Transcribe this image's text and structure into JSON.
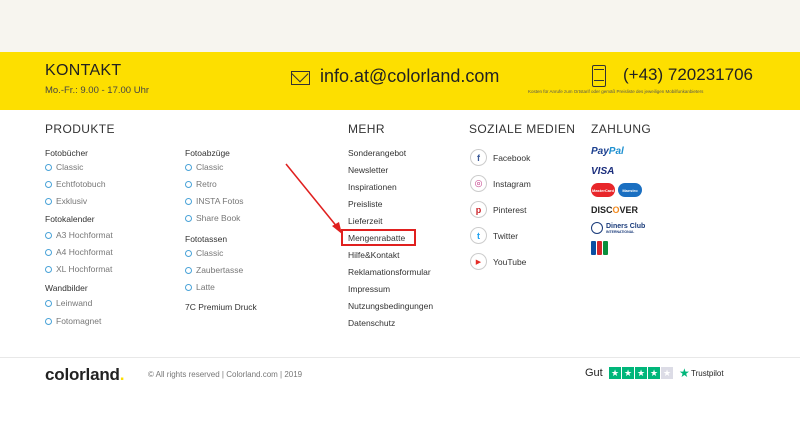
{
  "contact": {
    "title": "KONTAKT",
    "hours": "Mo.-Fr.: 9.00 - 17.00 Uhr",
    "email": "info.at@colorland.com",
    "phone": "(+43) 720231706",
    "phone_note": "Kosten für Anrufe zum Ortstarif oder gemäß Preisliste des jeweiligen Mobilfunkanbieters",
    "mail_icon": "mail-icon",
    "phone_icon": "mobile-phone-icon"
  },
  "produkte": {
    "title": "PRODUKTE",
    "fotobuecher": {
      "label": "Fotobücher",
      "items": [
        "Classic",
        "Echtfotobuch",
        "Exklusiv"
      ]
    },
    "fotokalender": {
      "label": "Fotokalender",
      "items": [
        "A3 Hochformat",
        "A4 Hochformat",
        "XL Hochformat"
      ]
    },
    "wandbilder": {
      "label": "Wandbilder",
      "items": [
        "Leinwand",
        "Fotomagnet"
      ]
    },
    "fotoabzuege": {
      "label": "Fotoabzüge",
      "items": [
        "Classic",
        "Retro",
        "INSTA Fotos",
        "Share Book"
      ]
    },
    "fototassen": {
      "label": "Fototassen",
      "items": [
        "Classic",
        "Zaubertasse",
        "Latte"
      ]
    },
    "premium": "7C Premium Druck"
  },
  "mehr": {
    "title": "MEHR",
    "items": [
      "Sonderangebot",
      "Newsletter",
      "Inspirationen",
      "Preisliste",
      "Lieferzeit",
      "Mengenrabatte",
      "Hilfe&Kontakt",
      "Reklamationsformular",
      "Impressum",
      "Nutzungsbedingungen",
      "Datenschutz"
    ]
  },
  "social": {
    "title": "SOZIALE MEDIEN",
    "items": [
      {
        "label": "Facebook",
        "glyph": "f",
        "color": "#3b5998",
        "icon": "facebook-icon"
      },
      {
        "label": "Instagram",
        "glyph": "◎",
        "color": "#c13584",
        "icon": "instagram-icon"
      },
      {
        "label": "Pinterest",
        "glyph": "p",
        "color": "#cb2027",
        "icon": "pinterest-icon"
      },
      {
        "label": "Twitter",
        "glyph": "t",
        "color": "#1da1f2",
        "icon": "twitter-icon"
      },
      {
        "label": "YouTube",
        "glyph": "▶",
        "color": "#e52d27",
        "icon": "youtube-icon"
      }
    ]
  },
  "zahlung": {
    "title": "ZAHLUNG",
    "paypal_a": "Pay",
    "paypal_b": "Pal",
    "visa": "VISA",
    "mastercard": "MasterCard",
    "maestro": "Maestro",
    "discover_a": "DISC",
    "discover_o": "O",
    "discover_b": "VER",
    "diners": "Diners Club",
    "diners_sub": "INTERNATIONAL",
    "colors": {
      "mastercard": "#e8262a",
      "maestro": "#1a6fc1",
      "jcb_blue": "#0b4ea2",
      "jcb_red": "#d7262c",
      "jcb_green": "#0a8f3c"
    }
  },
  "footer": {
    "logo_text": "colorland",
    "logo_dot": ".",
    "copyright": "© All rights reserved | Colorland.com | 2019",
    "rating_label": "Gut",
    "rating_stars": 4,
    "rating_max": 5,
    "trustpilot": "Trustpilot"
  },
  "colors": {
    "accent": "#fddf00",
    "highlight": "#e0201f",
    "bullet": "#4aa3d8",
    "trustpilot": "#00b67a"
  }
}
